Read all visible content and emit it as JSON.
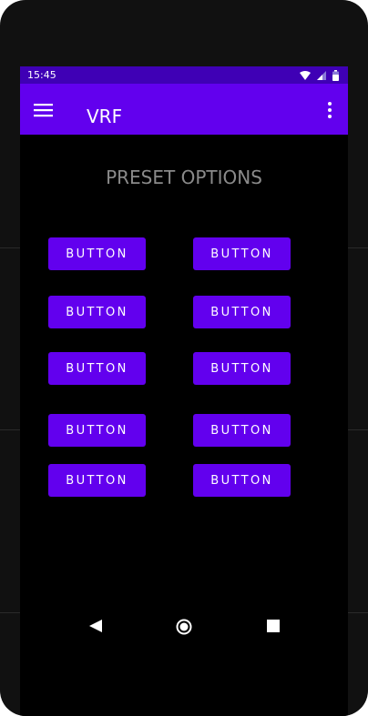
{
  "status_bar": {
    "time": "15:45",
    "background": "#3f00b5",
    "icons": [
      "wifi-icon",
      "cellular-signal-icon",
      "battery-icon"
    ]
  },
  "app_bar": {
    "title": "VRF",
    "background": "#6200ee",
    "left_icon": "hamburger-menu-icon",
    "right_icon": "overflow-menu-icon"
  },
  "heading": "PRESET OPTIONS",
  "buttons": {
    "background": "#6200ee",
    "labels": [
      "BUTTON",
      "BUTTON",
      "BUTTON",
      "BUTTON",
      "BUTTON",
      "BUTTON",
      "BUTTON",
      "BUTTON",
      "BUTTON",
      "BUTTON"
    ]
  },
  "nav_bar": {
    "icons": [
      "back-icon",
      "home-icon",
      "recents-icon"
    ]
  }
}
